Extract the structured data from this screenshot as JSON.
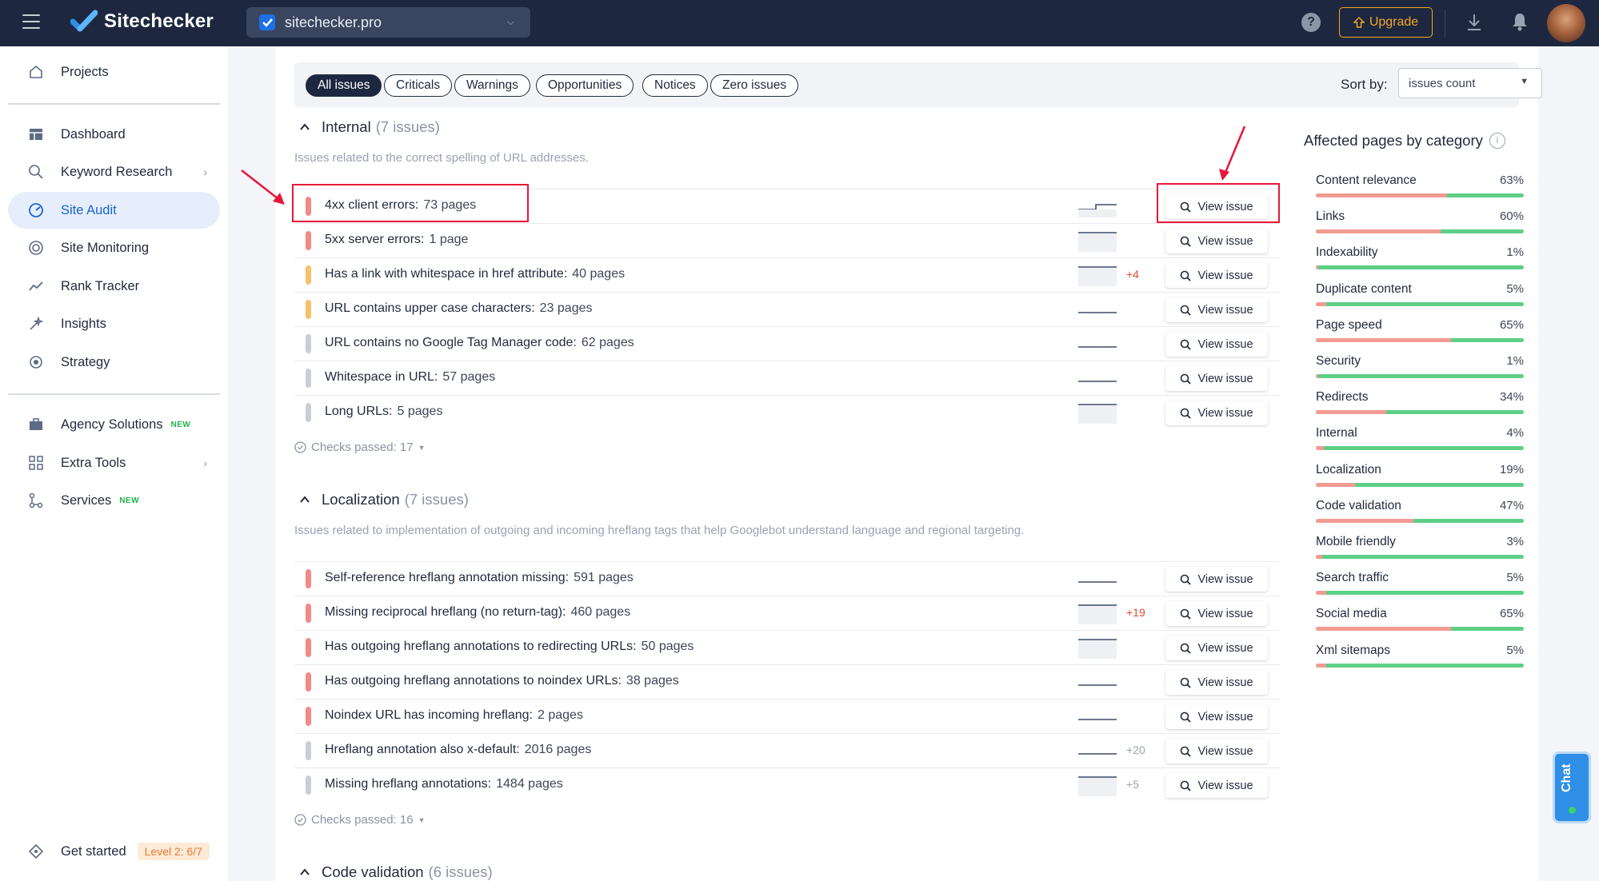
{
  "header": {
    "brand": "Sitechecker",
    "project": "sitechecker.pro",
    "upgrade_label": "Upgrade",
    "help_label": "?"
  },
  "sidebar": {
    "items": [
      {
        "label": "Projects",
        "icon": "home-icon"
      },
      {
        "label": "Dashboard",
        "icon": "dashboard-icon"
      },
      {
        "label": "Keyword Research",
        "icon": "keyword-research-icon"
      },
      {
        "label": "Site Audit",
        "icon": "site-audit-icon",
        "active": true
      },
      {
        "label": "Site Monitoring",
        "icon": "site-monitoring-icon"
      },
      {
        "label": "Rank Tracker",
        "icon": "rank-tracker-icon"
      },
      {
        "label": "Insights",
        "icon": "insights-icon"
      },
      {
        "label": "Strategy",
        "icon": "strategy-icon"
      },
      {
        "label": "Agency Solutions",
        "icon": "briefcase-icon",
        "badge": "NEW"
      },
      {
        "label": "Extra Tools",
        "icon": "extra-tools-icon"
      },
      {
        "label": "Services",
        "icon": "services-icon",
        "badge": "NEW"
      }
    ],
    "get_started": "Get started",
    "level": "Level 2: 6/7"
  },
  "filters": {
    "chips": [
      "All issues",
      "Criticals",
      "Warnings",
      "Opportunities",
      "Notices",
      "Zero issues"
    ],
    "sort_label": "Sort by:",
    "sort_value": "issues count"
  },
  "sections": [
    {
      "title": "Internal",
      "count": "(7 issues)",
      "description": "Issues related to the correct spelling of URL addresses.",
      "checks": "Checks passed: 17",
      "issues": [
        {
          "name": "4xx client errors:",
          "pages": "73 pages",
          "severity": "critical",
          "delta": ""
        },
        {
          "name": "5xx server errors:",
          "pages": "1 page",
          "severity": "critical",
          "delta": ""
        },
        {
          "name": "Has a link with whitespace in href attribute:",
          "pages": "40 pages",
          "severity": "warning",
          "delta": "+4"
        },
        {
          "name": "URL contains upper case characters:",
          "pages": "23 pages",
          "severity": "warning",
          "delta": ""
        },
        {
          "name": "URL contains no Google Tag Manager code:",
          "pages": "62 pages",
          "severity": "notice",
          "delta": ""
        },
        {
          "name": "Whitespace in URL:",
          "pages": "57 pages",
          "severity": "notice",
          "delta": ""
        },
        {
          "name": "Long URLs:",
          "pages": "5 pages",
          "severity": "notice",
          "delta": ""
        }
      ]
    },
    {
      "title": "Localization",
      "count": "(7 issues)",
      "description": "Issues related to implementation of outgoing and incoming hreflang tags that help Googlebot understand language and regional targeting.",
      "checks": "Checks passed: 16",
      "issues": [
        {
          "name": "Self-reference hreflang annotation missing:",
          "pages": "591 pages",
          "severity": "critical",
          "delta": ""
        },
        {
          "name": "Missing reciprocal hreflang (no return-tag):",
          "pages": "460 pages",
          "severity": "critical",
          "delta": "+19"
        },
        {
          "name": "Has outgoing hreflang annotations to redirecting URLs:",
          "pages": "50 pages",
          "severity": "critical",
          "delta": ""
        },
        {
          "name": "Has outgoing hreflang annotations to noindex URLs:",
          "pages": "38 pages",
          "severity": "critical",
          "delta": ""
        },
        {
          "name": "Noindex URL has incoming hreflang:",
          "pages": "2 pages",
          "severity": "critical",
          "delta": ""
        },
        {
          "name": "Hreflang annotation also x-default:",
          "pages": "2016 pages",
          "severity": "notice",
          "delta": "+20"
        },
        {
          "name": "Missing hreflang annotations:",
          "pages": "1484 pages",
          "severity": "notice",
          "delta": "+5"
        }
      ]
    },
    {
      "title": "Code validation",
      "count": "(6 issues)"
    }
  ],
  "view_issue_label": "View issue",
  "right_panel": {
    "title": "Affected pages by category",
    "categories": [
      {
        "label": "Content relevance",
        "pct": "63%",
        "value": 63
      },
      {
        "label": "Links",
        "pct": "60%",
        "value": 60
      },
      {
        "label": "Indexability",
        "pct": "1%",
        "value": 1
      },
      {
        "label": "Duplicate content",
        "pct": "5%",
        "value": 5
      },
      {
        "label": "Page speed",
        "pct": "65%",
        "value": 65
      },
      {
        "label": "Security",
        "pct": "1%",
        "value": 1
      },
      {
        "label": "Redirects",
        "pct": "34%",
        "value": 34
      },
      {
        "label": "Internal",
        "pct": "4%",
        "value": 4
      },
      {
        "label": "Localization",
        "pct": "19%",
        "value": 19
      },
      {
        "label": "Code validation",
        "pct": "47%",
        "value": 47
      },
      {
        "label": "Mobile friendly",
        "pct": "3%",
        "value": 3
      },
      {
        "label": "Search traffic",
        "pct": "5%",
        "value": 5
      },
      {
        "label": "Social media",
        "pct": "65%",
        "value": 65
      },
      {
        "label": "Xml sitemaps",
        "pct": "5%",
        "value": 5
      }
    ]
  },
  "chat_label": "Chat",
  "colors": {
    "critical": "#f08a86",
    "warning": "#f8c06a",
    "notice": "#c9cdd6",
    "delta_red": "#e8453c",
    "delta_grey": "#9aa3b2",
    "highlight": "#e8173a"
  }
}
